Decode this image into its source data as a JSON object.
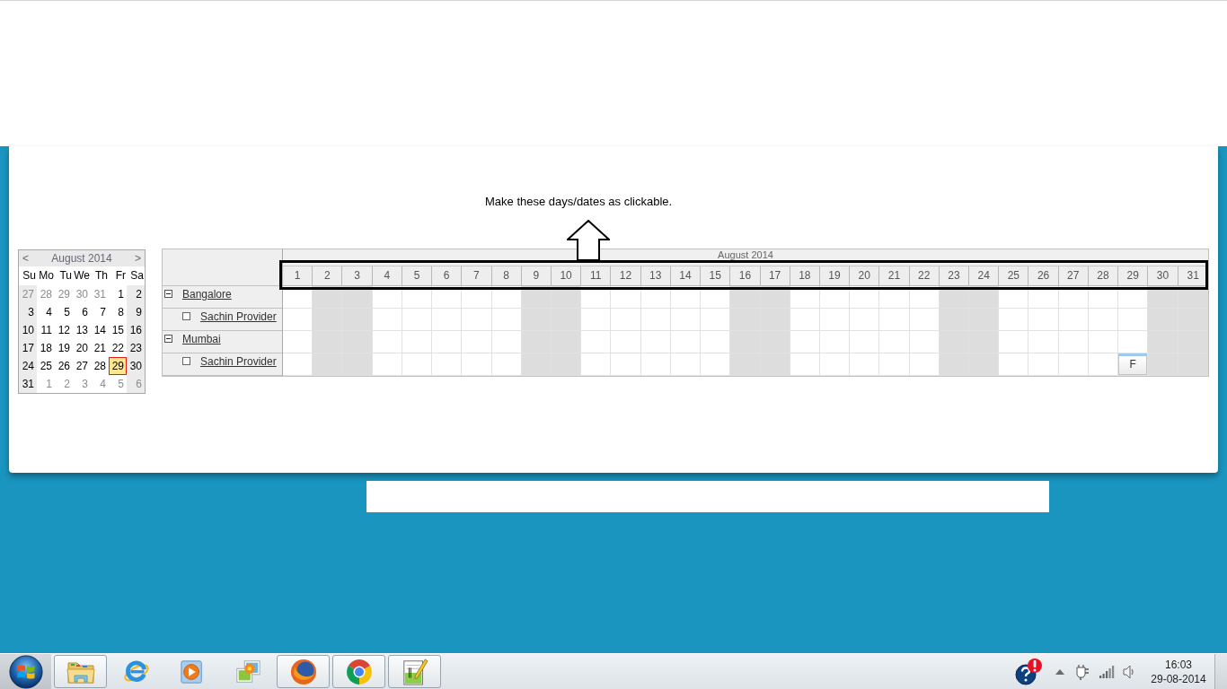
{
  "annotation": {
    "text": "Make these days/dates as clickable."
  },
  "mini_calendar": {
    "prev": "<",
    "title": "August 2014",
    "next": ">",
    "weekdays": [
      {
        "label": "Su",
        "weekend": true
      },
      {
        "label": "Mo",
        "weekend": false
      },
      {
        "label": "Tu",
        "weekend": false
      },
      {
        "label": "We",
        "weekend": false
      },
      {
        "label": "Th",
        "weekend": false
      },
      {
        "label": "Fr",
        "weekend": false
      },
      {
        "label": "Sa",
        "weekend": true
      }
    ],
    "weeks": [
      [
        {
          "day": "27",
          "other_month": true,
          "selected": false
        },
        {
          "day": "28",
          "other_month": true,
          "selected": false
        },
        {
          "day": "29",
          "other_month": true,
          "selected": false
        },
        {
          "day": "30",
          "other_month": true,
          "selected": false
        },
        {
          "day": "31",
          "other_month": true,
          "selected": false
        },
        {
          "day": "1",
          "other_month": false,
          "selected": false
        },
        {
          "day": "2",
          "other_month": false,
          "selected": false
        }
      ],
      [
        {
          "day": "3",
          "other_month": false,
          "selected": false
        },
        {
          "day": "4",
          "other_month": false,
          "selected": false
        },
        {
          "day": "5",
          "other_month": false,
          "selected": false
        },
        {
          "day": "6",
          "other_month": false,
          "selected": false
        },
        {
          "day": "7",
          "other_month": false,
          "selected": false
        },
        {
          "day": "8",
          "other_month": false,
          "selected": false
        },
        {
          "day": "9",
          "other_month": false,
          "selected": false
        }
      ],
      [
        {
          "day": "10",
          "other_month": false,
          "selected": false
        },
        {
          "day": "11",
          "other_month": false,
          "selected": false
        },
        {
          "day": "12",
          "other_month": false,
          "selected": false
        },
        {
          "day": "13",
          "other_month": false,
          "selected": false
        },
        {
          "day": "14",
          "other_month": false,
          "selected": false
        },
        {
          "day": "15",
          "other_month": false,
          "selected": false
        },
        {
          "day": "16",
          "other_month": false,
          "selected": false
        }
      ],
      [
        {
          "day": "17",
          "other_month": false,
          "selected": false
        },
        {
          "day": "18",
          "other_month": false,
          "selected": false
        },
        {
          "day": "19",
          "other_month": false,
          "selected": false
        },
        {
          "day": "20",
          "other_month": false,
          "selected": false
        },
        {
          "day": "21",
          "other_month": false,
          "selected": false
        },
        {
          "day": "22",
          "other_month": false,
          "selected": false
        },
        {
          "day": "23",
          "other_month": false,
          "selected": false
        }
      ],
      [
        {
          "day": "24",
          "other_month": false,
          "selected": false
        },
        {
          "day": "25",
          "other_month": false,
          "selected": false
        },
        {
          "day": "26",
          "other_month": false,
          "selected": false
        },
        {
          "day": "27",
          "other_month": false,
          "selected": false
        },
        {
          "day": "28",
          "other_month": false,
          "selected": false
        },
        {
          "day": "29",
          "other_month": false,
          "selected": true
        },
        {
          "day": "30",
          "other_month": false,
          "selected": false
        }
      ],
      [
        {
          "day": "31",
          "other_month": false,
          "selected": false
        },
        {
          "day": "1",
          "other_month": true,
          "selected": false
        },
        {
          "day": "2",
          "other_month": true,
          "selected": false
        },
        {
          "day": "3",
          "other_month": true,
          "selected": false
        },
        {
          "day": "4",
          "other_month": true,
          "selected": false
        },
        {
          "day": "5",
          "other_month": true,
          "selected": false
        },
        {
          "day": "6",
          "other_month": true,
          "selected": false
        }
      ]
    ]
  },
  "scheduler": {
    "month": "August 2014",
    "days": [
      {
        "label": "1",
        "weekend": false
      },
      {
        "label": "2",
        "weekend": true
      },
      {
        "label": "3",
        "weekend": true
      },
      {
        "label": "4",
        "weekend": false
      },
      {
        "label": "5",
        "weekend": false
      },
      {
        "label": "6",
        "weekend": false
      },
      {
        "label": "7",
        "weekend": false
      },
      {
        "label": "8",
        "weekend": false
      },
      {
        "label": "9",
        "weekend": true
      },
      {
        "label": "10",
        "weekend": true
      },
      {
        "label": "11",
        "weekend": false
      },
      {
        "label": "12",
        "weekend": false
      },
      {
        "label": "13",
        "weekend": false
      },
      {
        "label": "14",
        "weekend": false
      },
      {
        "label": "15",
        "weekend": false
      },
      {
        "label": "16",
        "weekend": true
      },
      {
        "label": "17",
        "weekend": true
      },
      {
        "label": "18",
        "weekend": false
      },
      {
        "label": "19",
        "weekend": false
      },
      {
        "label": "20",
        "weekend": false
      },
      {
        "label": "21",
        "weekend": false
      },
      {
        "label": "22",
        "weekend": false
      },
      {
        "label": "23",
        "weekend": true
      },
      {
        "label": "24",
        "weekend": true
      },
      {
        "label": "25",
        "weekend": false
      },
      {
        "label": "26",
        "weekend": false
      },
      {
        "label": "27",
        "weekend": false
      },
      {
        "label": "28",
        "weekend": false
      },
      {
        "label": "29",
        "weekend": false
      },
      {
        "label": "30",
        "weekend": true
      },
      {
        "label": "31",
        "weekend": true
      }
    ],
    "resources": [
      {
        "name": "Bangalore",
        "expanded": true,
        "children": [
          {
            "name": "Sachin Provider",
            "checked": false,
            "cells": [
              {
                "selected": false
              },
              {
                "selected": false
              },
              {
                "selected": false
              },
              {
                "selected": false
              },
              {
                "selected": false
              },
              {
                "selected": false
              },
              {
                "selected": false
              },
              {
                "selected": false
              },
              {
                "selected": false
              },
              {
                "selected": false
              },
              {
                "selected": false
              },
              {
                "selected": false
              },
              {
                "selected": false
              },
              {
                "selected": false
              },
              {
                "selected": false
              },
              {
                "selected": false
              },
              {
                "selected": false
              },
              {
                "selected": false
              },
              {
                "selected": false
              },
              {
                "selected": false
              },
              {
                "selected": false
              },
              {
                "selected": false
              },
              {
                "selected": false
              },
              {
                "selected": false
              },
              {
                "selected": false
              },
              {
                "selected": false
              },
              {
                "selected": false
              },
              {
                "selected": false
              },
              {
                "selected": false
              },
              {
                "selected": false
              },
              {
                "selected": false
              }
            ]
          }
        ]
      },
      {
        "name": "Mumbai",
        "expanded": true,
        "children": [
          {
            "name": "Sachin Provider",
            "checked": false,
            "cells": [
              {
                "selected": false
              },
              {
                "selected": false
              },
              {
                "selected": false
              },
              {
                "selected": false
              },
              {
                "selected": false
              },
              {
                "selected": false
              },
              {
                "selected": false
              },
              {
                "selected": false
              },
              {
                "selected": false
              },
              {
                "selected": false
              },
              {
                "selected": false
              },
              {
                "selected": false
              },
              {
                "selected": false
              },
              {
                "selected": false
              },
              {
                "selected": false
              },
              {
                "selected": false
              },
              {
                "selected": false
              },
              {
                "selected": false
              },
              {
                "selected": false
              },
              {
                "selected": false
              },
              {
                "selected": false
              },
              {
                "selected": false
              },
              {
                "selected": false
              },
              {
                "selected": false
              },
              {
                "selected": false
              },
              {
                "selected": false
              },
              {
                "selected": false
              },
              {
                "selected": false
              },
              {
                "event": "F"
              },
              {
                "selected": false
              },
              {
                "selected": false
              }
            ]
          }
        ]
      }
    ]
  },
  "taskbar": {
    "apps": [
      {
        "kind": "folder",
        "running": true
      },
      {
        "kind": "ie",
        "running": false
      },
      {
        "kind": "media",
        "running": false
      },
      {
        "kind": "photos",
        "running": false
      },
      {
        "kind": "firefox",
        "running": true
      },
      {
        "kind": "chrome",
        "running": true
      },
      {
        "kind": "notepad",
        "running": true
      }
    ],
    "clock": {
      "time": "16:03",
      "date": "29-08-2014"
    }
  }
}
